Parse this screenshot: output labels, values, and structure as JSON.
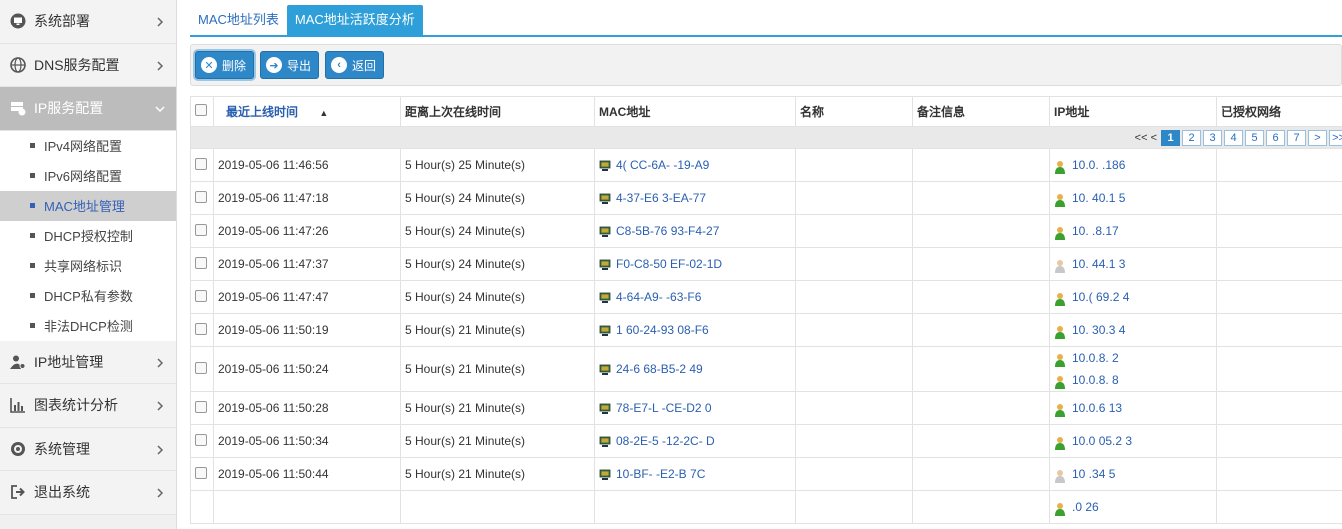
{
  "sidebar": {
    "menus": [
      {
        "label": "系统部署",
        "icon": "monitor-icon"
      },
      {
        "label": "DNS服务配置",
        "icon": "globe-icon"
      },
      {
        "label": "IP服务配置",
        "icon": "server-icon"
      },
      {
        "label": "IP地址管理",
        "icon": "user-gear-icon"
      },
      {
        "label": "图表统计分析",
        "icon": "bar-chart-icon"
      },
      {
        "label": "系统管理",
        "icon": "gear-icon"
      },
      {
        "label": "退出系统",
        "icon": "logout-icon"
      }
    ],
    "sub_items": [
      "IPv4网络配置",
      "IPv6网络配置",
      "MAC地址管理",
      "DHCP授权控制",
      "共享网络标识",
      "DHCP私有参数",
      "非法DHCP检测"
    ]
  },
  "tabs": [
    "MAC地址列表",
    "MAC地址活跃度分析"
  ],
  "toolbar": {
    "delete": "删除",
    "export": "导出",
    "back": "返回"
  },
  "table": {
    "headers": [
      "最近上线时间",
      "距离上次在线时间",
      "MAC地址",
      "名称",
      "备注信息",
      "IP地址",
      "已授权网络"
    ],
    "pager": {
      "prefix": "<< <",
      "pages": [
        "1",
        "2",
        "3",
        "4",
        "5",
        "6",
        "7"
      ],
      "next": ">",
      "last": ">>"
    },
    "rows": [
      {
        "time": "2019-05-06 11:46:56",
        "since": "5 Hour(s) 25 Minute(s)",
        "mac": "4( CC-6A- -19-A9",
        "ips": [
          "10.0. .186"
        ]
      },
      {
        "time": "2019-05-06 11:47:18",
        "since": "5 Hour(s) 24 Minute(s)",
        "mac": "4-37-E6 3-EA-77",
        "ips": [
          "10. 40.1 5"
        ]
      },
      {
        "time": "2019-05-06 11:47:26",
        "since": "5 Hour(s) 24 Minute(s)",
        "mac": "C8-5B-76 93-F4-27",
        "ips": [
          "10. .8.17"
        ]
      },
      {
        "time": "2019-05-06 11:47:37",
        "since": "5 Hour(s) 24 Minute(s)",
        "mac": "F0-C8-50 EF-02-1D",
        "ips": [
          "10. 44.1 3"
        ]
      },
      {
        "time": "2019-05-06 11:47:47",
        "since": "5 Hour(s) 24 Minute(s)",
        "mac": "4-64-A9- -63-F6",
        "ips": [
          "10.( 69.2 4"
        ]
      },
      {
        "time": "2019-05-06 11:50:19",
        "since": "5 Hour(s) 21 Minute(s)",
        "mac": "1 60-24-93 08-F6",
        "ips": [
          "10. 30.3 4"
        ]
      },
      {
        "time": "2019-05-06 11:50:24",
        "since": "5 Hour(s) 21 Minute(s)",
        "mac": "24-6 68-B5-2 49",
        "ips": [
          "10.0.8. 2",
          "10.0.8. 8"
        ]
      },
      {
        "time": "2019-05-06 11:50:28",
        "since": "5 Hour(s) 21 Minute(s)",
        "mac": "78-E7-L -CE-D2 0",
        "ips": [
          "10.0.6 13"
        ]
      },
      {
        "time": "2019-05-06 11:50:34",
        "since": "5 Hour(s) 21 Minute(s)",
        "mac": "08-2E-5 -12-2C- D",
        "ips": [
          "10.0 05.2 3"
        ]
      },
      {
        "time": "2019-05-06 11:50:44",
        "since": "5 Hour(s) 21 Minute(s)",
        "mac": "10-BF- -E2-B 7C",
        "ips": [
          "10 .34 5"
        ]
      },
      {
        "time": "",
        "since": "",
        "mac": "",
        "ips": [
          ".0 26"
        ]
      }
    ]
  },
  "colors": {
    "accent": "#2e9fd8",
    "button": "#2e87c7",
    "link": "#2a5fb0",
    "sidebar_active": "#bcbcbc"
  }
}
